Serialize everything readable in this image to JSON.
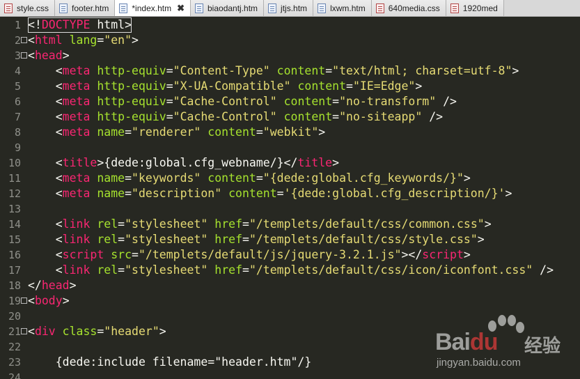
{
  "tabs": [
    {
      "label": "style.css",
      "icon": "css-file-icon",
      "active": false
    },
    {
      "label": "footer.htm",
      "icon": "html-file-icon",
      "active": false
    },
    {
      "label": "*index.htm",
      "icon": "html-file-icon",
      "active": true
    },
    {
      "label": "biaodantj.htm",
      "icon": "html-file-icon",
      "active": false
    },
    {
      "label": "jtjs.htm",
      "icon": "html-file-icon",
      "active": false
    },
    {
      "label": "lxwm.htm",
      "icon": "html-file-icon",
      "active": false
    },
    {
      "label": "640media.css",
      "icon": "css-file-icon",
      "active": false
    },
    {
      "label": "1920med",
      "icon": "css-file-icon",
      "active": false
    }
  ],
  "close_glyph": "✖",
  "line_numbers": [
    "1",
    "2",
    "3",
    "4",
    "5",
    "6",
    "7",
    "8",
    "9",
    "10",
    "11",
    "12",
    "13",
    "14",
    "15",
    "16",
    "17",
    "18",
    "19",
    "20",
    "21",
    "22",
    "23",
    "24"
  ],
  "code": {
    "l1": [
      "<!",
      "DOCTYPE",
      " html",
      ">"
    ],
    "l2": [
      "<",
      "html",
      " lang",
      "=",
      "\"en\"",
      ">"
    ],
    "l3": [
      "<",
      "head",
      ">"
    ],
    "l4": [
      "    <",
      "meta",
      " http-equiv",
      "=",
      "\"Content-Type\"",
      " content",
      "=",
      "\"text/html; charset=utf-8\"",
      ">"
    ],
    "l5": [
      "    <",
      "meta",
      " http-equiv",
      "=",
      "\"X-UA-Compatible\"",
      " content",
      "=",
      "\"IE=Edge\"",
      ">"
    ],
    "l6": [
      "    <",
      "meta",
      " http-equiv",
      "=",
      "\"Cache-Control\"",
      " content",
      "=",
      "\"no-transform\"",
      " />"
    ],
    "l7": [
      "    <",
      "meta",
      " http-equiv",
      "=",
      "\"Cache-Control\"",
      " content",
      "=",
      "\"no-siteapp\"",
      " />"
    ],
    "l8": [
      "    <",
      "meta",
      " name",
      "=",
      "\"renderer\"",
      " content",
      "=",
      "\"webkit\"",
      ">"
    ],
    "l10": [
      "    <",
      "title",
      ">{dede:global.cfg_webname/}</",
      "title",
      ">"
    ],
    "l11": [
      "    <",
      "meta",
      " name",
      "=",
      "\"keywords\"",
      " content",
      "=",
      "\"{dede:global.cfg_keywords/}\"",
      ">"
    ],
    "l12": [
      "    <",
      "meta",
      " name",
      "=",
      "\"description\"",
      " content",
      "=",
      "'{dede:global.cfg_description/}'",
      ">"
    ],
    "l14": [
      "    <",
      "link",
      " rel",
      "=",
      "\"stylesheet\"",
      " href",
      "=",
      "\"/templets/default/css/common.css\"",
      ">"
    ],
    "l15": [
      "    <",
      "link",
      " rel",
      "=",
      "\"stylesheet\"",
      " href",
      "=",
      "\"/templets/default/css/style.css\"",
      ">"
    ],
    "l16": [
      "    <",
      "script",
      " src",
      "=",
      "\"/templets/default/js/jquery-3.2.1.js\"",
      "></",
      "script",
      ">"
    ],
    "l17": [
      "    <",
      "link",
      " rel",
      "=",
      "\"stylesheet\"",
      " href",
      "=",
      "\"/templets/default/css/icon/iconfont.css\"",
      " />"
    ],
    "l18": [
      "</",
      "head",
      ">"
    ],
    "l19": [
      "<",
      "body",
      ">"
    ],
    "l21": [
      "<",
      "div",
      " class",
      "=",
      "\"header\"",
      ">"
    ],
    "l23": [
      "    {dede:include filename=\"header.htm\"/}"
    ]
  },
  "watermark": {
    "brand": "Bai",
    "brand2": "du",
    "cn": "经验",
    "url": "jingyan.baidu.com"
  }
}
